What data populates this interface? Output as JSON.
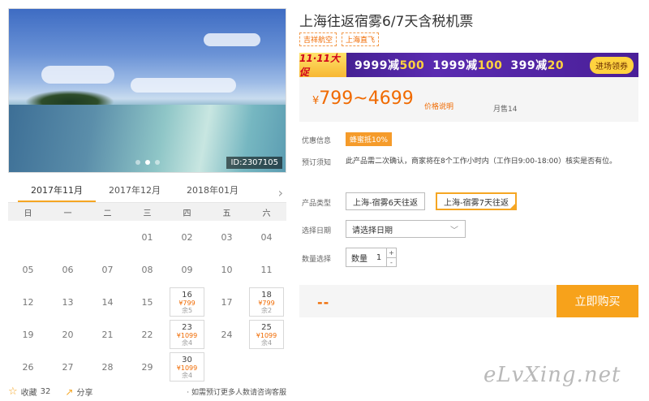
{
  "photo": {
    "id_label": "ID:2307105"
  },
  "calendar": {
    "months": [
      "2017年11月",
      "2017年12月",
      "2018年01月"
    ],
    "weekdays": [
      "日",
      "一",
      "二",
      "三",
      "四",
      "五",
      "六"
    ],
    "days": [
      {
        "n": ""
      },
      {
        "n": ""
      },
      {
        "n": ""
      },
      {
        "n": "01"
      },
      {
        "n": "02"
      },
      {
        "n": "03"
      },
      {
        "n": "04"
      },
      {
        "n": "05"
      },
      {
        "n": "06"
      },
      {
        "n": "07"
      },
      {
        "n": "08"
      },
      {
        "n": "09"
      },
      {
        "n": "10"
      },
      {
        "n": "11"
      },
      {
        "n": "12"
      },
      {
        "n": "13"
      },
      {
        "n": "14"
      },
      {
        "n": "15"
      },
      {
        "n": "16",
        "price": "¥799",
        "left": "余5"
      },
      {
        "n": "17"
      },
      {
        "n": "18",
        "price": "¥799",
        "left": "余2"
      },
      {
        "n": "19"
      },
      {
        "n": "20"
      },
      {
        "n": "21"
      },
      {
        "n": "22"
      },
      {
        "n": "23",
        "price": "¥1099",
        "left": "余4"
      },
      {
        "n": "24"
      },
      {
        "n": "25",
        "price": "¥1099",
        "left": "余4"
      },
      {
        "n": "26"
      },
      {
        "n": "27"
      },
      {
        "n": "28"
      },
      {
        "n": "29"
      },
      {
        "n": "30",
        "price": "¥1099",
        "left": "余4"
      },
      {
        "n": ""
      },
      {
        "n": ""
      }
    ]
  },
  "bottom": {
    "fav_label": "收藏",
    "fav_count": "32",
    "share_label": "分享",
    "note": "· 如需预订更多人数请咨询客服"
  },
  "product": {
    "title": "上海往返宿雾6/7天含税机票",
    "tags": [
      "吉祥航空",
      "上海直飞"
    ]
  },
  "promo": {
    "badge": "11·11大促",
    "deals": [
      {
        "full": "9999减",
        "off": "500"
      },
      {
        "full": "1999减",
        "off": "100"
      },
      {
        "full": "399减",
        "off": "20"
      }
    ],
    "enter_label": "进场领券"
  },
  "price": {
    "currency": "¥",
    "range": "799~4699",
    "explain": "价格说明",
    "sold": "月售14"
  },
  "labels": {
    "discount": "优惠信息",
    "notice": "预订须知",
    "type": "产品类型",
    "date": "选择日期",
    "qty": "数量选择"
  },
  "discount_pill": "蜂蜜抵10%",
  "notice_text": "此产品需二次确认，商家将在8个工作小时内（工作日9:00-18:00）核实是否有位。",
  "options": [
    "上海-宿雾6天往返",
    "上海-宿雾7天往返"
  ],
  "date_select": {
    "placeholder": "请选择日期"
  },
  "quantity": {
    "label": "数量",
    "value": "1",
    "plus": "+",
    "minus": "-"
  },
  "buy": {
    "total": "--",
    "button": "立即购买"
  },
  "watermark": "eLvXing.net"
}
